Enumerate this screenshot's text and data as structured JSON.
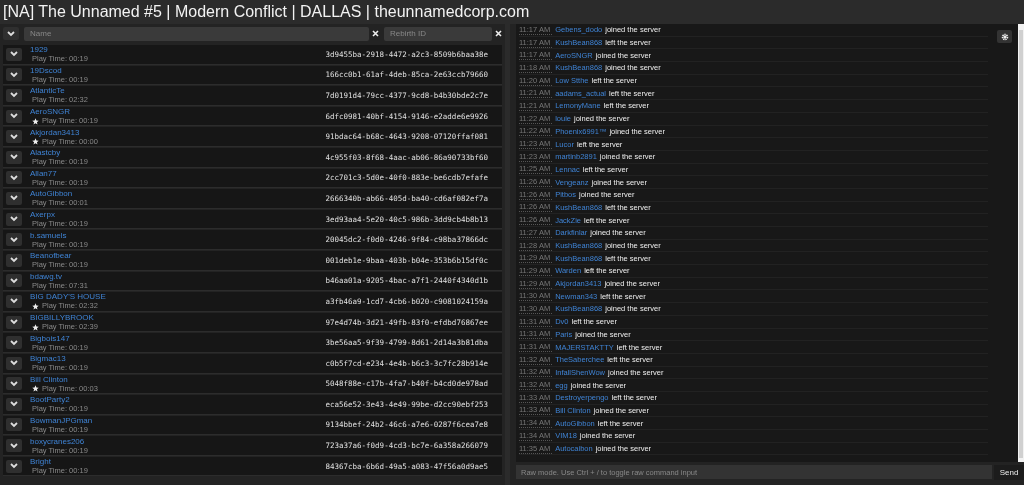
{
  "window": {
    "title": "[NA] The Unnamed #5 | Modern Conflict | DALLAS | theunnamedcorp.com"
  },
  "filters": [
    {
      "placeholder": "Name"
    },
    {
      "placeholder": "Rebirth ID"
    }
  ],
  "players": [
    {
      "name": "1929",
      "play_time": "Play Time: 00:19",
      "id": "3d9455ba-2918-4472-a2c3-8509b6baa38e",
      "starred": false
    },
    {
      "name": "19Dscod",
      "play_time": "Play Time: 00:19",
      "id": "166cc0b1-61af-4deb-85ca-2e63ccb79660",
      "starred": false
    },
    {
      "name": "AtlanticTe",
      "play_time": "Play Time: 02:32",
      "id": "7d0191d4-79cc-4377-9cd8-b4b30bde2c7e",
      "starred": false
    },
    {
      "name": "AeroSNGR",
      "play_time": "Play Time: 00:19",
      "id": "6dfc0981-40bf-4154-9146-e2adde6e9926",
      "starred": true
    },
    {
      "name": "Akjordan3413",
      "play_time": "Play Time: 00:00",
      "id": "91bdac64-b68c-4643-9208-07120ffaf081",
      "starred": true
    },
    {
      "name": "Alastcby",
      "play_time": "Play Time: 00:19",
      "id": "4c955f03-8f68-4aac-ab06-86a90733bf60",
      "starred": false
    },
    {
      "name": "Allan77",
      "play_time": "Play Time: 00:19",
      "id": "2cc701c3-5d0e-40f0-883e-be6cdb7efafe",
      "starred": false
    },
    {
      "name": "AutoGibbon",
      "play_time": "Play Time: 00:01",
      "id": "2666340b-ab66-405d-ba40-cd6af082ef7a",
      "starred": false
    },
    {
      "name": "Axerpx",
      "play_time": "Play Time: 00:19",
      "id": "3ed93aa4-5e20-40c5-986b-3dd9cb4b8b13",
      "starred": false
    },
    {
      "name": "b.samuels",
      "play_time": "Play Time: 00:19",
      "id": "20045dc2-f0d0-4246-9f84-c98ba37866dc",
      "starred": false
    },
    {
      "name": "Beanofbear",
      "play_time": "Play Time: 00:19",
      "id": "001deb1e-9baa-403b-b04e-353b6b15df0c",
      "starred": false
    },
    {
      "name": "bdawg.tv",
      "play_time": "Play Time: 07:31",
      "id": "b46aa01a-9205-4bac-a7f1-2440f4340d1b",
      "starred": false
    },
    {
      "name": "BIG DADY'S HOUSE",
      "play_time": "Play Time: 02:32",
      "id": "a3fb46a9-1cd7-4cb6-b020-c9081024159a",
      "starred": true
    },
    {
      "name": "BIGBILLYBROOK",
      "play_time": "Play Time: 02:39",
      "id": "97e4d74b-3d21-49fb-83f0-efdbd76867ee",
      "starred": true
    },
    {
      "name": "Bigbois147",
      "play_time": "Play Time: 00:19",
      "id": "3be56aa5-9f39-4799-8d61-2d14a3b81dba",
      "starred": false
    },
    {
      "name": "Bigmac13",
      "play_time": "Play Time: 00:19",
      "id": "c0b5f7cd-e234-4e4b-b6c3-3c7fc28b914e",
      "starred": false
    },
    {
      "name": "Bill Clinton",
      "play_time": "Play Time: 00:03",
      "id": "5048f88e-c17b-4fa7-b40f-b4cd0de978ad",
      "starred": true
    },
    {
      "name": "BootParty2",
      "play_time": "Play Time: 00:19",
      "id": "eca56e52-3e43-4e49-99be-d2cc90ebf253",
      "starred": false
    },
    {
      "name": "BowmanJPGman",
      "play_time": "Play Time: 00:19",
      "id": "9134bbef-24b2-46c6-a7e6-0287f6cea7e8",
      "starred": false
    },
    {
      "name": "boxycranes206",
      "play_time": "Play Time: 00:19",
      "id": "723a37a6-f0d9-4cd3-bc7e-6a358a266079",
      "starred": false
    },
    {
      "name": "Bright",
      "play_time": "Play Time: 00:19",
      "id": "84367cba-6b6d-49a5-a083-47f56a0d9ae5",
      "starred": false
    }
  ],
  "log": [
    {
      "time": "11:17 AM",
      "player": "Gebens_dodo",
      "event": "joined the server"
    },
    {
      "time": "11:17 AM",
      "player": "KushBean868",
      "event": "left the server"
    },
    {
      "time": "11:17 AM",
      "player": "AeroSNGR",
      "event": "joined the server"
    },
    {
      "time": "11:18 AM",
      "player": "KushBean868",
      "event": "joined the server"
    },
    {
      "time": "11:20 AM",
      "player": "Low Stthe",
      "event": "left the server"
    },
    {
      "time": "11:21 AM",
      "player": "aadams_actual",
      "event": "left the server"
    },
    {
      "time": "11:21 AM",
      "player": "LemonyMane",
      "event": "left the server"
    },
    {
      "time": "11:22 AM",
      "player": "louie",
      "event": "joined the server"
    },
    {
      "time": "11:22 AM",
      "player": "Phoenix6991™",
      "event": "joined the server"
    },
    {
      "time": "11:23 AM",
      "player": "Lucor",
      "event": "left the server"
    },
    {
      "time": "11:23 AM",
      "player": "martinb2891",
      "event": "joined the server"
    },
    {
      "time": "11:25 AM",
      "player": "Lennac",
      "event": "left the server"
    },
    {
      "time": "11:26 AM",
      "player": "Vengeanz",
      "event": "joined the server"
    },
    {
      "time": "11:26 AM",
      "player": "Pitbos",
      "event": "joined the server"
    },
    {
      "time": "11:26 AM",
      "player": "KushBean868",
      "event": "left the server"
    },
    {
      "time": "11:26 AM",
      "player": "JackZie",
      "event": "left the server"
    },
    {
      "time": "11:27 AM",
      "player": "Darkfinlar",
      "event": "joined the server"
    },
    {
      "time": "11:28 AM",
      "player": "KushBean868",
      "event": "joined the server"
    },
    {
      "time": "11:29 AM",
      "player": "KushBean868",
      "event": "left the server"
    },
    {
      "time": "11:29 AM",
      "player": "Warden",
      "event": "left the server"
    },
    {
      "time": "11:29 AM",
      "player": "Akjordan3413",
      "event": "joined the server"
    },
    {
      "time": "11:30 AM",
      "player": "Newman343",
      "event": "left the server"
    },
    {
      "time": "11:30 AM",
      "player": "KushBean868",
      "event": "joined the server"
    },
    {
      "time": "11:31 AM",
      "player": "Dv0",
      "event": "left the server"
    },
    {
      "time": "11:31 AM",
      "player": "Paris",
      "event": "joined the server"
    },
    {
      "time": "11:31 AM",
      "player": "MAJERSTAKTTY",
      "event": "left the server"
    },
    {
      "time": "11:32 AM",
      "player": "TheSaberchee",
      "event": "left the server"
    },
    {
      "time": "11:32 AM",
      "player": "InfallShenWow",
      "event": "joined the server"
    },
    {
      "time": "11:32 AM",
      "player": "egg",
      "event": "joined the server"
    },
    {
      "time": "11:33 AM",
      "player": "Destroyerpengo",
      "event": "left the server"
    },
    {
      "time": "11:33 AM",
      "player": "Bill Clinton",
      "event": "joined the server"
    },
    {
      "time": "11:34 AM",
      "player": "AutoGibbon",
      "event": "left the server"
    },
    {
      "time": "11:34 AM",
      "player": "VIM18",
      "event": "joined the server"
    },
    {
      "time": "11:35 AM",
      "player": "Autocaibon",
      "event": "joined the server"
    }
  ],
  "command": {
    "placeholder": "Raw mode. Use Ctrl + / to toggle raw command input",
    "button": "Send"
  }
}
